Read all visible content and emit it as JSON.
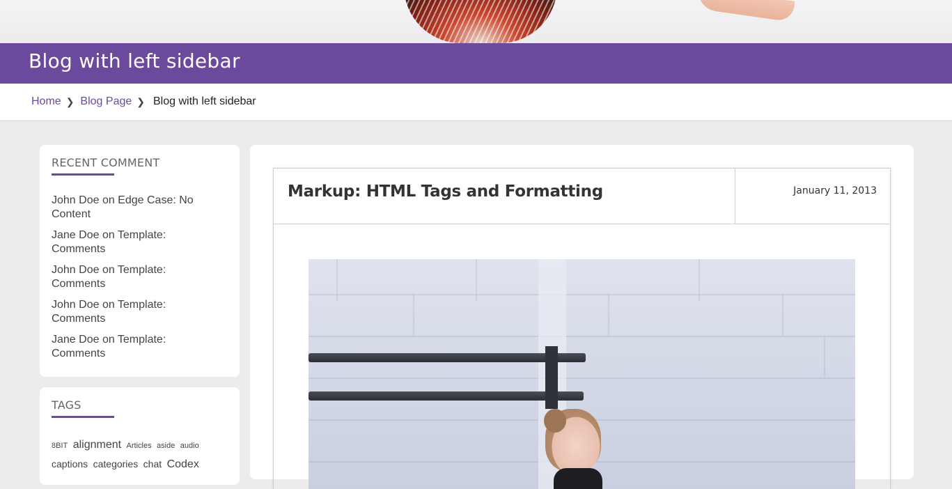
{
  "page": {
    "title": "Blog with left sidebar"
  },
  "breadcrumb": {
    "items": [
      {
        "label": "Home"
      },
      {
        "label": "Blog Page"
      }
    ],
    "current": "Blog with left sidebar"
  },
  "sidebar": {
    "recent_comments": {
      "heading": "RECENT COMMENT",
      "items": [
        "John Doe on Edge Case: No Content",
        "Jane Doe on Template: Comments",
        "John Doe on Template: Comments",
        "John Doe on Template: Comments",
        "Jane Doe on Template: Comments"
      ]
    },
    "tags": {
      "heading": "TAGS",
      "items": [
        "8BIT",
        "alignment",
        "Articles",
        "aside",
        "audio",
        "captions",
        "categories",
        "chat",
        "Codex"
      ]
    }
  },
  "post": {
    "title": "Markup: HTML Tags and Formatting",
    "date": "January 11, 2013"
  },
  "colors": {
    "accent": "#6b4a9e"
  }
}
